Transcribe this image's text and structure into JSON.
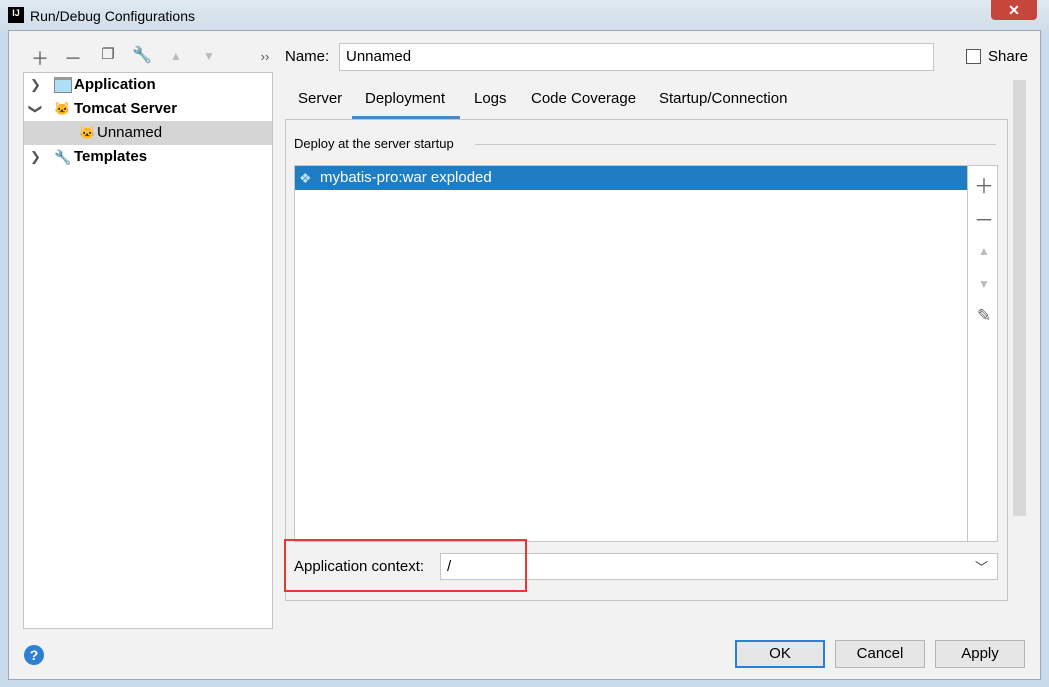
{
  "window": {
    "title": "Run/Debug Configurations",
    "app_icon": "IJ"
  },
  "toolbar": {
    "icons": [
      "plus-icon",
      "minus-icon",
      "copy-icon",
      "wrench-icon",
      "arrow-up-icon",
      "arrow-down-icon",
      "more-icon"
    ],
    "more": "››"
  },
  "tree": {
    "items": [
      {
        "label": "Application",
        "level": 0,
        "expanded": false,
        "bold": true
      },
      {
        "label": "Tomcat Server",
        "level": 0,
        "expanded": true,
        "bold": true
      },
      {
        "label": "Unnamed",
        "level": 1,
        "selected": true
      },
      {
        "label": "Templates",
        "level": 0,
        "expanded": false,
        "bold": true
      }
    ]
  },
  "name": {
    "label": "Name:",
    "value": "Unnamed"
  },
  "share": {
    "label": "Share",
    "checked": false
  },
  "tabs": [
    {
      "label": "Server"
    },
    {
      "label": "Deployment",
      "active": true
    },
    {
      "label": "Logs"
    },
    {
      "label": "Code Coverage"
    },
    {
      "label": "Startup/Connection"
    }
  ],
  "deployment": {
    "section_label": "Deploy at the server startup",
    "items": [
      {
        "label": "mybatis-pro:war exploded",
        "selected": true
      }
    ],
    "context_label": "Application context:",
    "context_value": "/"
  },
  "buttons": {
    "ok": "OK",
    "cancel": "Cancel",
    "apply": "Apply",
    "help": "?"
  },
  "colors": {
    "accent": "#1f7dc4",
    "highlight_box": "#e53935"
  }
}
